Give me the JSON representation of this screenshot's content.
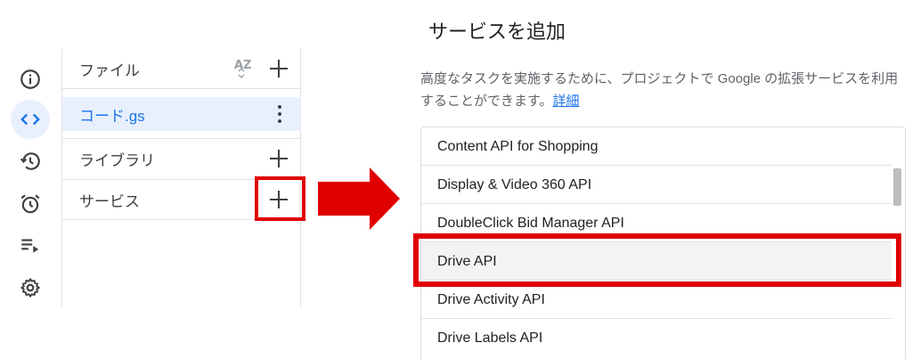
{
  "rail": {
    "items": [
      {
        "icon": "info-icon"
      },
      {
        "icon": "code-icon",
        "active": true
      },
      {
        "icon": "history-icon"
      },
      {
        "icon": "alarm-icon"
      },
      {
        "icon": "playlist-play-icon"
      },
      {
        "icon": "gear-icon"
      }
    ]
  },
  "panel": {
    "files_label": "ファイル",
    "sort_label": "AZ",
    "file_name": "コード.gs",
    "libraries_label": "ライブラリ",
    "services_label": "サービス"
  },
  "dialog": {
    "title": "サービスを追加",
    "description": "高度なタスクを実施するために、プロジェクトで Google の拡張サービスを利用することができます。",
    "learn_more": "詳細",
    "services": [
      "Content API for Shopping",
      "Display & Video 360 API",
      "DoubleClick Bid Manager API",
      "Drive API",
      "Drive Activity API",
      "Drive Labels API"
    ],
    "selected_service": "Drive API"
  },
  "colors": {
    "accent": "#1a73e8",
    "active_bg": "#e8f0fe",
    "highlight": "#e00000"
  }
}
